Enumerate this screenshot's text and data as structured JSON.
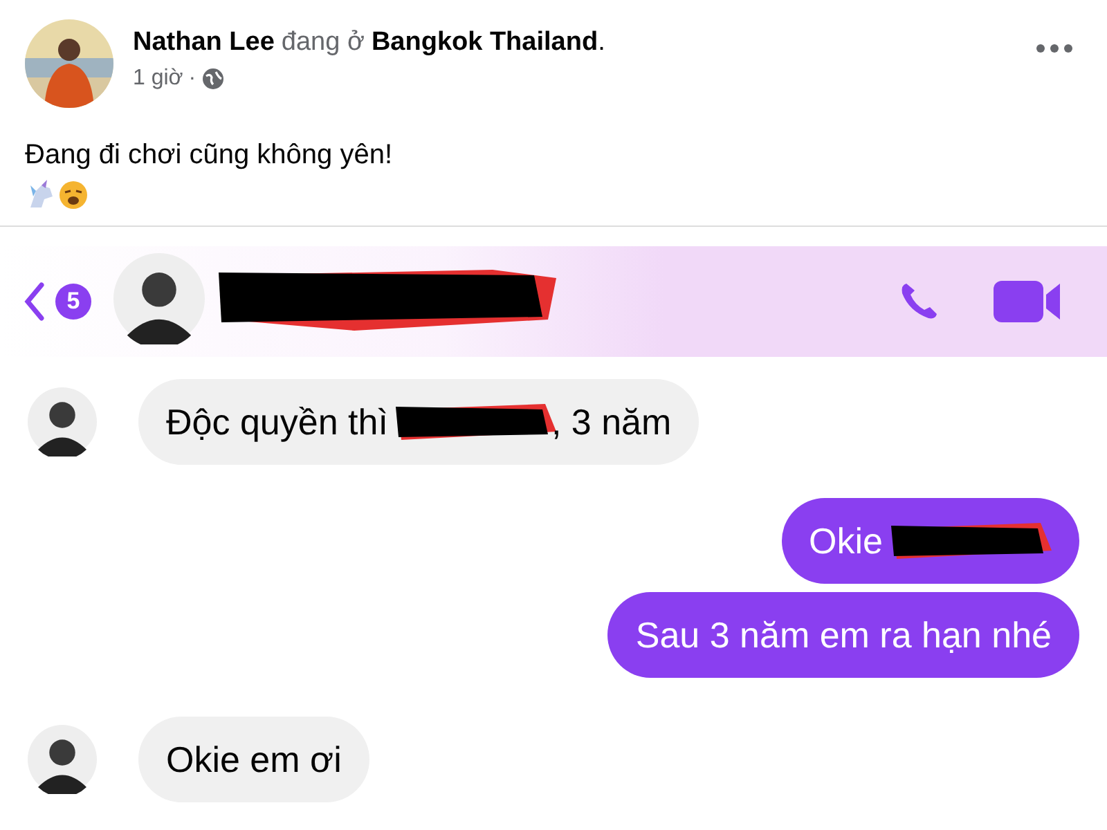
{
  "post": {
    "author": "Nathan Lee",
    "action": "đang ở",
    "place": "Bangkok Thailand",
    "end": ".",
    "time": "1 giờ",
    "separator": "·",
    "text": "Đang đi chơi cũng không yên!"
  },
  "chat": {
    "back_count": "5",
    "messages": [
      {
        "kind": "incoming",
        "parts": [
          {
            "kind": "text",
            "text": "Độc quyền thì"
          },
          {
            "kind": "redacted"
          },
          {
            "kind": "text",
            "text": ", 3 năm"
          }
        ]
      },
      {
        "kind": "outgoing",
        "parts": [
          {
            "kind": "text",
            "text": "Okie"
          },
          {
            "kind": "redacted"
          }
        ]
      },
      {
        "kind": "outgoing",
        "parts": [
          {
            "kind": "text",
            "text": "Sau 3 năm em ra hạn nhé"
          }
        ]
      },
      {
        "kind": "incoming",
        "parts": [
          {
            "kind": "text",
            "text": "Okie em ơi"
          }
        ]
      }
    ]
  }
}
